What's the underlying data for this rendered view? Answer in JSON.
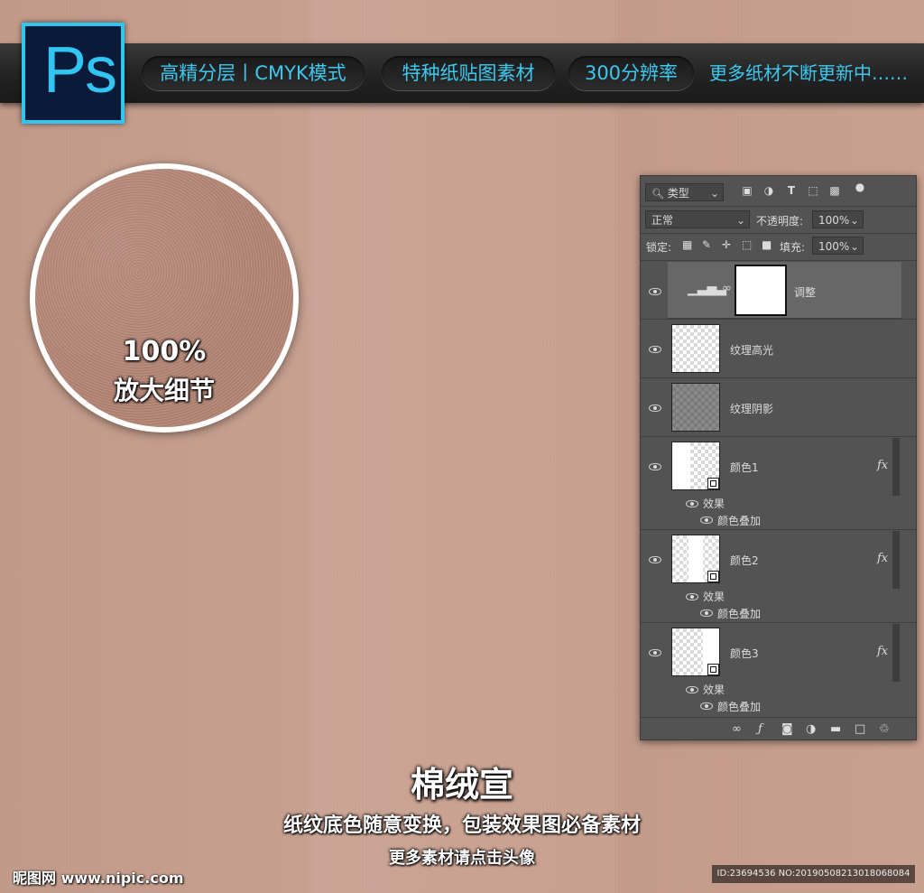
{
  "banner": {
    "logo_text": "Ps",
    "pills": [
      "高精分层丨CMYK模式",
      "特种纸贴图素材",
      "300分辨率"
    ],
    "note": "更多纸材不断更新中……"
  },
  "magnifier": {
    "line1": "100%",
    "line2": "放大细节"
  },
  "layers_panel": {
    "filter_label": "类型",
    "blend_mode": "正常",
    "opacity_label": "不透明度:",
    "opacity_value": "100%",
    "lock_label": "锁定:",
    "fill_label": "填充:",
    "fill_value": "100%",
    "layers": [
      {
        "name": "调整"
      },
      {
        "name": "纹理高光"
      },
      {
        "name": "纹理阴影"
      },
      {
        "name": "颜色1",
        "effects_label": "效果",
        "effect": "颜色叠加"
      },
      {
        "name": "颜色2",
        "effects_label": "效果",
        "effect": "颜色叠加"
      },
      {
        "name": "颜色3",
        "effects_label": "效果",
        "effect": "颜色叠加"
      }
    ],
    "fx_label": "fx"
  },
  "footer": {
    "title": "棉绒宣",
    "subtitle": "纸纹底色随意变换，包装效果图必备素材",
    "cta": "更多素材请点击头像",
    "watermark": "昵图网 www.nipic.com",
    "id_info": "ID:23694536 NO:20190508213018068084"
  },
  "colors": {
    "accent": "#3ec8ef",
    "panel_bg": "#535353",
    "selected_layer": "#676767"
  }
}
